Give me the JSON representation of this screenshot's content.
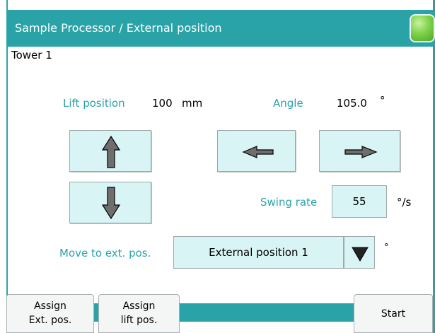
{
  "window": {
    "title": "Sample Processor / External position"
  },
  "tower": {
    "label": "Tower 1"
  },
  "lift": {
    "label": "Lift position",
    "value": "100",
    "unit": "mm"
  },
  "angle": {
    "label": "Angle",
    "value": "105.0",
    "unit": "°"
  },
  "swing": {
    "label": "Swing rate",
    "value": "55",
    "unit": "°/s"
  },
  "move": {
    "label": "Move to ext. pos.",
    "selected": "External position 1",
    "unit": "°"
  },
  "footer": {
    "assign_ext": [
      "Assign",
      "Ext. pos."
    ],
    "assign_lift": [
      "Assign",
      "lift pos."
    ],
    "start": "Start"
  },
  "colors": {
    "accent": "#2aa3a8",
    "button_fill": "#d8f4f4",
    "status_led": "#7fd34a"
  },
  "icons": [
    "arrow-up-icon",
    "arrow-down-icon",
    "arrow-left-icon",
    "arrow-right-icon",
    "dropdown-triangle-icon",
    "status-led-icon"
  ]
}
